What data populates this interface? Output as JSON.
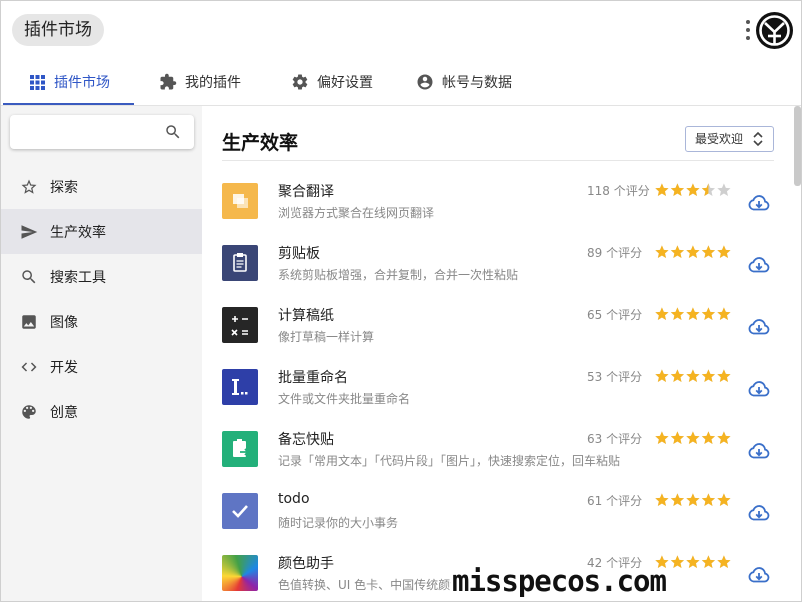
{
  "window": {
    "title": "插件市场"
  },
  "tabs": [
    {
      "label": "插件市场",
      "icon": "grid-icon",
      "active": true
    },
    {
      "label": "我的插件",
      "icon": "puzzle-icon",
      "active": false
    },
    {
      "label": "偏好设置",
      "icon": "gear-icon",
      "active": false
    },
    {
      "label": "帐号与数据",
      "icon": "account-icon",
      "active": false
    }
  ],
  "search": {
    "value": "",
    "placeholder": ""
  },
  "sidebar": {
    "items": [
      {
        "label": "探索",
        "icon": "star-outline-icon"
      },
      {
        "label": "生产效率",
        "icon": "send-icon",
        "active": true
      },
      {
        "label": "搜索工具",
        "icon": "search-icon"
      },
      {
        "label": "图像",
        "icon": "image-icon"
      },
      {
        "label": "开发",
        "icon": "code-icon"
      },
      {
        "label": "创意",
        "icon": "palette-icon"
      }
    ]
  },
  "main": {
    "title": "生产效率",
    "sort": {
      "selected": "最受欢迎"
    },
    "plugins": [
      {
        "name": "聚合翻译",
        "desc": "浏览器方式聚合在线网页翻译",
        "rating": "118 个评分",
        "stars": 3.5,
        "icon_color": "#f5b84c"
      },
      {
        "name": "剪贴板",
        "desc": "系统剪贴板增强，合并复制，合并一次性粘贴",
        "rating": "89 个评分",
        "stars": 5,
        "icon_color": "#3a4676"
      },
      {
        "name": "计算稿纸",
        "desc": "像打草稿一样计算",
        "rating": "65 个评分",
        "stars": 5,
        "icon_color": "#262626"
      },
      {
        "name": "批量重命名",
        "desc": "文件或文件夹批量重命名",
        "rating": "53 个评分",
        "stars": 5,
        "icon_color": "#2e3fa8"
      },
      {
        "name": "备忘快贴",
        "desc": "记录「常用文本」「代码片段」「图片」，快速搜索定位，回车粘贴",
        "rating": "63 个评分",
        "stars": 5,
        "icon_color": "#23b07a"
      },
      {
        "name": "todo",
        "desc": "随时记录你的大小事务",
        "rating": "61 个评分",
        "stars": 5,
        "icon_color": "#5f75c4"
      },
      {
        "name": "颜色助手",
        "desc": "色值转换、UI 色卡、中国传统颜色",
        "rating": "42 个评分",
        "stars": 5,
        "icon_color": "#e24a3b"
      }
    ]
  },
  "watermark": "misspecos.com",
  "colors": {
    "accent": "#2f56c6",
    "star": "#f5b321",
    "star_empty": "#cfcfcf",
    "download": "#3a6fc9"
  }
}
